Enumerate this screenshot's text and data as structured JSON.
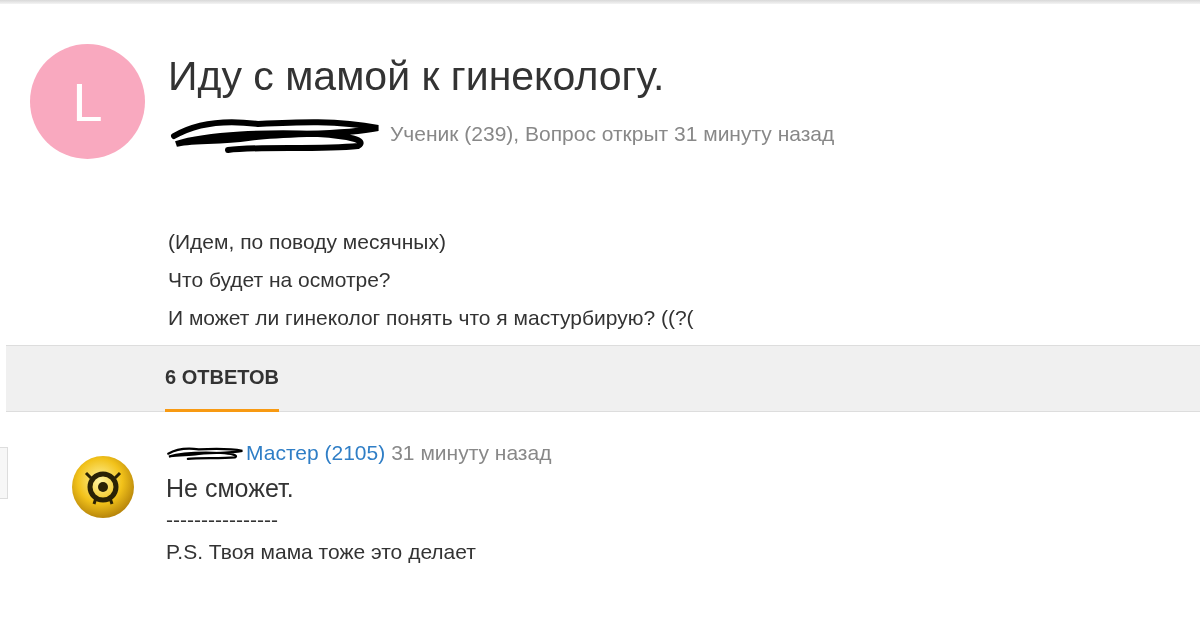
{
  "question": {
    "avatar_letter": "L",
    "title": "Иду с мамой к гинекологу.",
    "author_meta": "Ученик (239), Вопрос открыт 31 минуту назад",
    "body": [
      "(Идем, по поводу месячных)",
      "Что будет на осмотре?",
      "И может ли гинеколог понять что я мастурбирую? ((?("
    ]
  },
  "tabs": [
    {
      "label": "6 ОТВЕТОВ",
      "selected": true
    }
  ],
  "answers": [
    {
      "rank": "Мастер (2105)",
      "time": "31 минуту назад",
      "lines": [
        "Не сможет.",
        "----------------",
        "P.S. Твоя мама тоже это делает"
      ]
    }
  ]
}
